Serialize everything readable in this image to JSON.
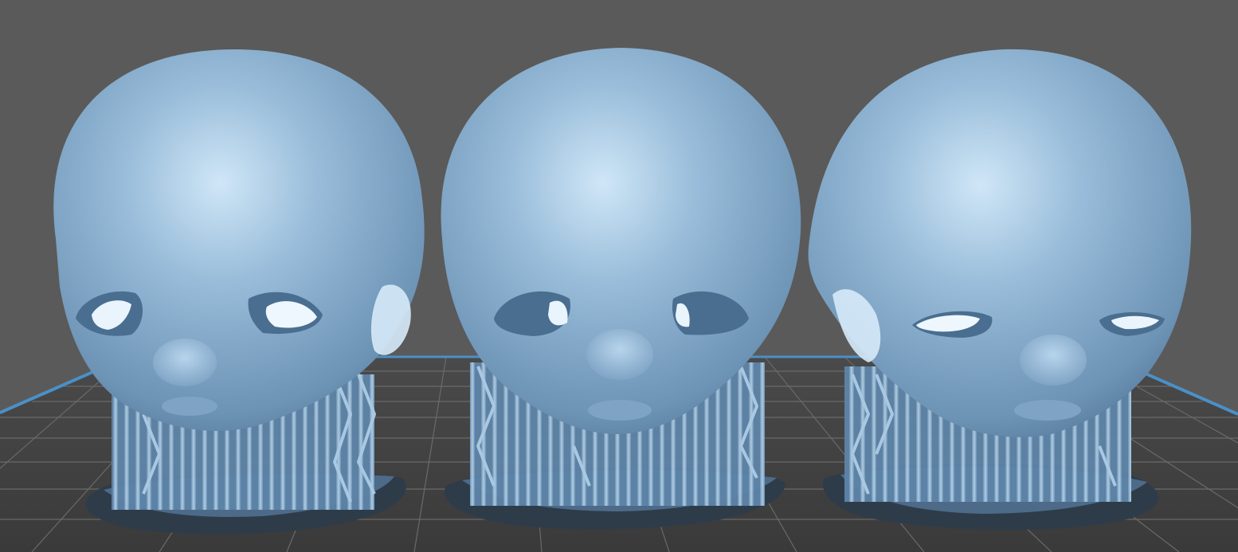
{
  "viewport": {
    "background_color": "#5a5a5a",
    "plate_color": "#3f3f3f",
    "grid_line_color": "#6f6f6f",
    "axis_color": "#4a90c8",
    "model_color": "#7fa6c7",
    "model_highlight": "#c9e2f5",
    "model_shadow": "#4d6f8f",
    "support_color": "#8fb4d4",
    "raft_color": "#2e3c4a"
  },
  "models": [
    {
      "id": "head-left",
      "kind": "doll-head-with-supports",
      "gaze": "right"
    },
    {
      "id": "head-center",
      "kind": "doll-head-with-supports",
      "gaze": "forward"
    },
    {
      "id": "head-right",
      "kind": "doll-head-with-supports",
      "gaze": "left"
    }
  ]
}
